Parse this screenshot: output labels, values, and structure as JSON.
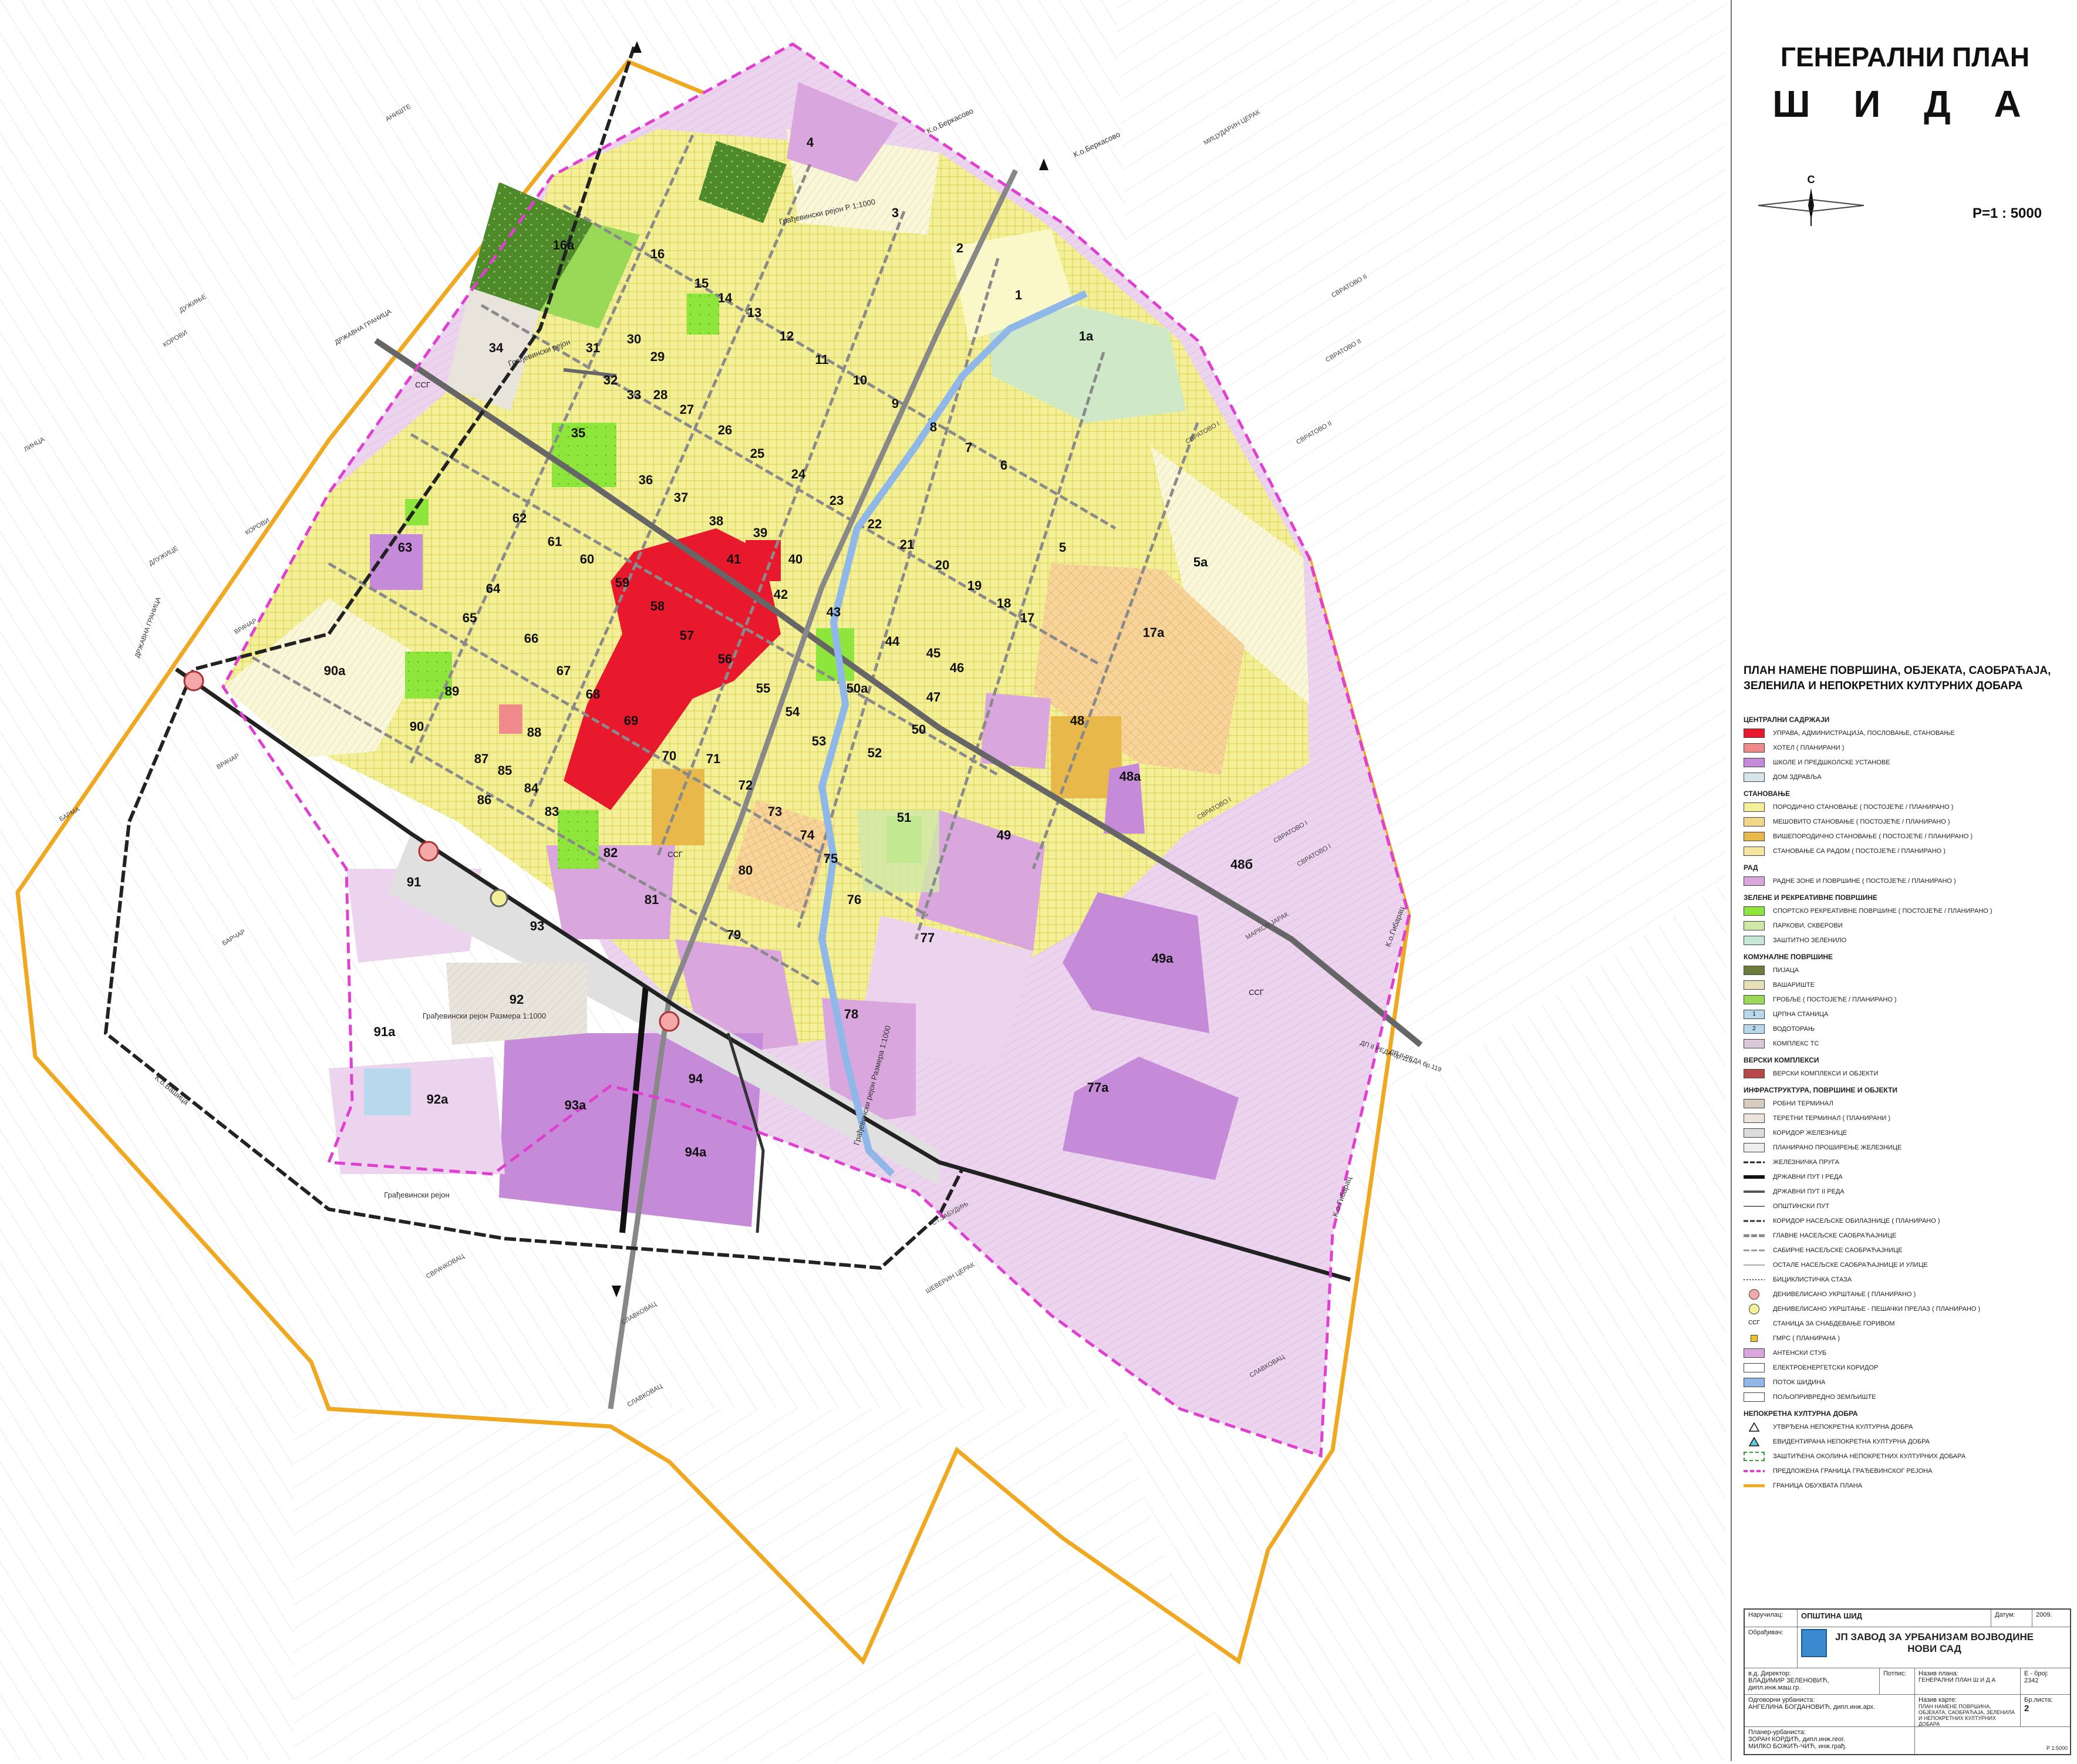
{
  "title": "ГЕНЕРАЛНИ ПЛАН",
  "subtitle": "Ш И Д А",
  "scale": "Р=1 : 5000",
  "north_label": "С",
  "legend_title": "ПЛАН НАМЕНЕ ПОВРШИНА, ОБЈЕКАТА, САОБРАЋАЈА, ЗЕЛЕНИЛА И НЕПОКРЕТНИХ КУЛТУРНИХ ДОБАРА",
  "colors": {
    "residential": "#f4f09a",
    "residential_light": "#faf8c8",
    "center": "#e8192c",
    "work": "#d9a6dd",
    "work_light": "#ecd3ee",
    "sport": "#8ee63c",
    "park": "#cfe8a8",
    "forest": "#4f8a2a",
    "border_pink": "#e040d0",
    "border_orange": "#f0a820",
    "stream": "#8fb8e8",
    "road": "#888888",
    "rail": "#222222"
  },
  "legend": [
    {
      "section": "ЦЕНТРАЛНИ САДРЖАЈИ",
      "items": [
        {
          "label": "УПРАВА, АДМИНИСТРАЦИЈА, ПОСЛОВАЊЕ, СТАНОВАЊЕ",
          "color": "#e8192c",
          "kind": "fill"
        },
        {
          "label": "ХОТЕЛ ( ПЛАНИРАНИ )",
          "color": "#f08a8a",
          "kind": "fill"
        },
        {
          "label": "ШКОЛЕ И ПРЕДШКОЛСКЕ УСТАНОВЕ",
          "color": "#c58ad8",
          "kind": "fill"
        },
        {
          "label": "ДОМ ЗДРАВЉА",
          "color": "#d6e4ec",
          "kind": "fill"
        }
      ]
    },
    {
      "section": "СТАНОВАЊЕ",
      "items": [
        {
          "label": "ПОРОДИЧНО СТАНОВАЊЕ ( ПОСТОЈЕЋЕ / ПЛАНИРАНО )",
          "color": "#f4f09a",
          "kind": "fill"
        },
        {
          "label": "МЕШОВИТО СТАНОВАЊЕ ( ПОСТОЈЕЋЕ / ПЛАНИРАНО )",
          "color": "#f4d88a",
          "kind": "fill"
        },
        {
          "label": "ВИШЕПОРОДИЧНО СТАНОВАЊЕ ( ПОСТОЈЕЋЕ / ПЛАНИРАНО )",
          "color": "#e8b84a",
          "kind": "fill"
        },
        {
          "label": "СТАНОВАЊЕ СА РАДОМ ( ПОСТОЈЕЋЕ / ПЛАНИРАНО )",
          "color": "#f6e6a0",
          "kind": "fill"
        }
      ]
    },
    {
      "section": "РАД",
      "items": [
        {
          "label": "РАДНЕ ЗОНЕ И ПОВРШИНЕ ( ПОСТОЈЕЋЕ / ПЛАНИРАНО )",
          "color": "#d9a6dd",
          "kind": "fill"
        }
      ]
    },
    {
      "section": "ЗЕЛЕНЕ И РЕКРЕАТИВНЕ ПОВРШИНЕ",
      "items": [
        {
          "label": "СПОРТСКО РЕКРЕАТИВНЕ ПОВРШИНЕ ( ПОСТОЈЕЋЕ / ПЛАНИРАНО )",
          "color": "#8ee63c",
          "kind": "fill"
        },
        {
          "label": "ПАРКОВИ, СКВЕРОВИ",
          "color": "#cfe8a8",
          "kind": "fill"
        },
        {
          "label": "ЗАШТИТНО ЗЕЛЕНИЛО",
          "color": "#c6e8d4",
          "kind": "fill"
        }
      ]
    },
    {
      "section": "КОМУНАЛНЕ ПОВРШИНЕ",
      "items": [
        {
          "label": "ПИЈАЦА",
          "color": "#6b7d3a",
          "kind": "fill"
        },
        {
          "label": "ВАШАРИШТЕ",
          "color": "#e8e0b8",
          "kind": "fill"
        },
        {
          "label": "ГРОБЉЕ ( ПОСТОЈЕЋЕ / ПЛАНИРАНО )",
          "color": "#9ad858",
          "kind": "fill"
        },
        {
          "label": "ЦРПНА СТАНИЦА",
          "color": "#b8d8ec",
          "kind": "fill",
          "tag": "1"
        },
        {
          "label": "ВОДОТОРАЊ",
          "color": "#b8d8ec",
          "kind": "fill",
          "tag": "2"
        },
        {
          "label": "КОМПЛЕКС ТС",
          "color": "#d8c8d8",
          "kind": "fill"
        }
      ]
    },
    {
      "section": "ВЕРСКИ КОМПЛЕКСИ",
      "items": [
        {
          "label": "ВЕРСКИ КОМПЛЕКСИ И ОБЈЕКТИ",
          "color": "#b84848",
          "kind": "fill"
        }
      ]
    },
    {
      "section": "ИНФРАСТРУКТУРА, ПОВРШИНЕ И ОБЈЕКТИ",
      "items": [
        {
          "label": "РОБНИ ТЕРМИНАЛ",
          "color": "#d8ccc0",
          "kind": "fill"
        },
        {
          "label": "ТЕРЕТНИ ТЕРМИНАЛ ( ПЛАНИРАНИ )",
          "color": "#ece4dc",
          "kind": "fill"
        },
        {
          "label": "КОРИДОР ЖЕЛЕЗНИЦЕ",
          "color": "#dcdcdc",
          "kind": "fill"
        },
        {
          "label": "ПЛАНИРАНО ПРОШИРЕЊЕ ЖЕЛЕЗНИЦЕ",
          "color": "#eeeeee",
          "kind": "fill"
        },
        {
          "label": "ЖЕЛЕЗНИЧКА ПРУГА",
          "color": "#222222",
          "kind": "line",
          "style": "rail"
        },
        {
          "label": "ДРЖАВНИ ПУТ I РЕДА",
          "color": "#111111",
          "kind": "line",
          "style": "thick"
        },
        {
          "label": "ДРЖАВНИ ПУТ II РЕДА",
          "color": "#555555",
          "kind": "line",
          "style": "medium"
        },
        {
          "label": "ОПШТИНСКИ ПУТ",
          "color": "#777777",
          "kind": "line",
          "style": "thin"
        },
        {
          "label": "КОРИДОР НАСЕЉСКЕ ОБИЛАЗНИЦЕ ( ПЛАНИРАНО )",
          "color": "#333333",
          "kind": "line",
          "style": "dash"
        },
        {
          "label": "ГЛАВНЕ НАСЕЉСКЕ САОБРАЋАЈНИЦЕ",
          "color": "#888888",
          "kind": "line",
          "style": "double"
        },
        {
          "label": "САБИРНЕ НАСЕЉСКЕ САОБРАЋАЈНИЦЕ",
          "color": "#999999",
          "kind": "line",
          "style": "double-thin"
        },
        {
          "label": "ОСТАЛЕ НАСЕЉСКЕ САОБРАЋАЈНИЦЕ И УЛИЦЕ",
          "color": "#aaaaaa",
          "kind": "line",
          "style": "thin"
        },
        {
          "label": "БИЦИКЛИСТИЧКА СТАЗА",
          "color": "#444444",
          "kind": "line",
          "style": "dot"
        }
      ]
    },
    {
      "section": "",
      "items": [
        {
          "label": "ДЕНИВЕЛИСАНО УКРШТАЊЕ ( ПЛАНИРАНО )",
          "color": "#f4a8a8",
          "kind": "circle"
        },
        {
          "label": "ДЕНИВЕЛИСАНО УКРШТАЊЕ - ПЕШАЧКИ ПРЕЛАЗ ( ПЛАНИРАНО )",
          "color": "#f4f09a",
          "kind": "circle"
        },
        {
          "label": "СТАНИЦА ЗА СНАБДЕВАЊЕ ГОРИВОМ",
          "color": "#ffffff",
          "kind": "text",
          "tag": "ССГ"
        },
        {
          "label": "ГМРС ( ПЛАНИРАНА )",
          "color": "#f0c020",
          "kind": "square"
        },
        {
          "label": "АНТЕНСКИ СТУБ",
          "color": "#d9a6dd",
          "kind": "fill"
        },
        {
          "label": "ЕЛЕКТРОЕНЕРГЕТСКИ КОРИДОР",
          "color": "#ffffff",
          "kind": "fill"
        },
        {
          "label": "ПОТОК ШИДИНА",
          "color": "#8fb8e8",
          "kind": "fill"
        },
        {
          "label": "ПОЉОПРИВРЕДНО ЗЕМЉИШТЕ",
          "color": "#ffffff",
          "kind": "fill"
        }
      ]
    },
    {
      "section": "НЕПОКРЕТНА КУЛТУРНА ДОБРА",
      "items": [
        {
          "label": "УТВРЂЕНА НЕПОКРЕТНА КУЛТУРНА ДОБРА",
          "color": "#ffffff",
          "kind": "triangle"
        },
        {
          "label": "ЕВИДЕНТИРАНА НЕПОКРЕТНА КУЛТУРНА ДОБРА",
          "color": "#60c8d8",
          "kind": "triangle"
        },
        {
          "label": "ЗАШТИЋЕНА ОКОЛИНА НЕПОКРЕТНИХ КУЛТУРНИХ ДОБАРА",
          "color": "#2aa82a",
          "kind": "dashbox"
        }
      ]
    },
    {
      "section": "",
      "items": [
        {
          "label": "ПРЕДЛОЖЕНА ГРАНИЦА ГРАЂЕВИНСКОГ РЕЈОНА",
          "color": "#e040d0",
          "kind": "line",
          "style": "pinkdash"
        },
        {
          "label": "ГРАНИЦА ОБУХВАТА ПЛАНА",
          "color": "#f0a820",
          "kind": "line",
          "style": "orange"
        }
      ]
    }
  ],
  "title_block": {
    "client_label": "Наручилац:",
    "client": "ОПШТИНА ШИД",
    "date_label": "Датум:",
    "date": "2009.",
    "maker_label": "Обрађивач:",
    "maker_line1": "ЈП ЗАВОД ЗА УРБАНИЗАМ ВОЈВОДИНЕ",
    "maker_line2": "НОВИ САД",
    "director_label": "в.д. Директор:",
    "director": "ВЛАДИМИР ЗЕЛЕНОВИЋ, дипл.инж.маш.гр.",
    "signature_label": "Потпис:",
    "plan_name_label": "Назив плана:",
    "plan_name": "ГЕНЕРАЛНИ ПЛАН Ш И Д А",
    "number_label": "Е - број:",
    "number": "2342",
    "responsible_label": "Одговорни урбаниста:",
    "responsible": "АНГЕЛИНА БОГДАНОВИЋ, дипл.инж.арх.",
    "map_name_label": "Назив карте:",
    "map_name": "ПЛАН НАМЕНЕ ПОВРШИНА, ОБЈЕКАТА, САОБРАЋАЈА, ЗЕЛЕНИЛА И НЕПОКРЕТНИХ КУЛТУРНИХ ДОБАРА",
    "sheet_label": "Бр.листа:",
    "sheet": "2",
    "planners_label": "Планер-урбаниста:",
    "planner1": "ЗОРАН КОРДИЋ, дипл.инж.геог.",
    "planner2": "МИЛКО БОЖИЋ-ЧИЋ, инж.грађ.",
    "scale_note": "Р 1:5000"
  },
  "map_labels": {
    "zones": [
      "1",
      "1а",
      "2",
      "3",
      "4",
      "5",
      "5а",
      "6",
      "7",
      "8",
      "9",
      "10",
      "11",
      "12",
      "13",
      "14",
      "15",
      "16",
      "16а",
      "17",
      "17а",
      "18",
      "19",
      "20",
      "21",
      "22",
      "23",
      "24",
      "25",
      "26",
      "27",
      "28",
      "29",
      "30",
      "31",
      "32",
      "33",
      "34",
      "35",
      "36",
      "37",
      "38",
      "39",
      "40",
      "41",
      "42",
      "43",
      "44",
      "45",
      "46",
      "47",
      "48",
      "48а",
      "48б",
      "49",
      "49а",
      "50",
      "50а",
      "51",
      "52",
      "53",
      "54",
      "55",
      "56",
      "57",
      "58",
      "59",
      "60",
      "61",
      "62",
      "63",
      "64",
      "65",
      "66",
      "67",
      "68",
      "69",
      "70",
      "71",
      "72",
      "73",
      "74",
      "75",
      "76",
      "77",
      "77а",
      "78",
      "79",
      "80",
      "81",
      "82",
      "83",
      "84",
      "85",
      "86",
      "87",
      "88",
      "89",
      "90",
      "90а",
      "91",
      "91а",
      "92",
      "92а",
      "93",
      "93а",
      "94",
      "94а"
    ],
    "fuel_station": "ССГ",
    "cadastral": [
      "К.о.Беркасово",
      "К.о.Беркасово",
      "К.о.Гибарац",
      "К.о.Гибарац",
      "К.о.Вашица"
    ],
    "regions": [
      "Грађевински реjон Р 1:1000",
      "Грађевински реjон",
      "Грађевински реjон Размера 1:1000",
      "Грађевински реjон Размера 1:1000",
      "Грађевински реjон"
    ],
    "field_names": [
      "АНИШТЕ",
      "ДУЖИЊЕ",
      "КОРОВИ",
      "ЛИНЦА",
      "ДЛУЖИЦЕ",
      "КОРОВИ",
      "ВРАЧАР",
      "ВРАЧАР",
      "БАРМА",
      "БАРЧАР",
      "СВРАТОВО II",
      "СВРАТОВО II",
      "СВРАТОВО II",
      "СВРАТОВО I",
      "СВРАТОВО I",
      "СВРАТОВО I",
      "СВРАТОВО I",
      "МАРКОВ ЈАРАК",
      "МИЦУДАРИН ЦЕРАК",
      "СЛАВКОВАЦ",
      "СЛАВКОВАЦ",
      "СЛАВКОВАЦ",
      "СВРАЧКОВАЦ",
      "ШЕВЕРИН ЦЕРАК",
      "СТ.ЗАБУДИЊ"
    ],
    "road_labels": [
      "ДРЖАВНА ГРАНИЦА",
      "ДРЖАВНА ГРАНИЦА",
      "ДП II РЕДА бр.119",
      "ДП II РЕДА бр.119"
    ]
  }
}
